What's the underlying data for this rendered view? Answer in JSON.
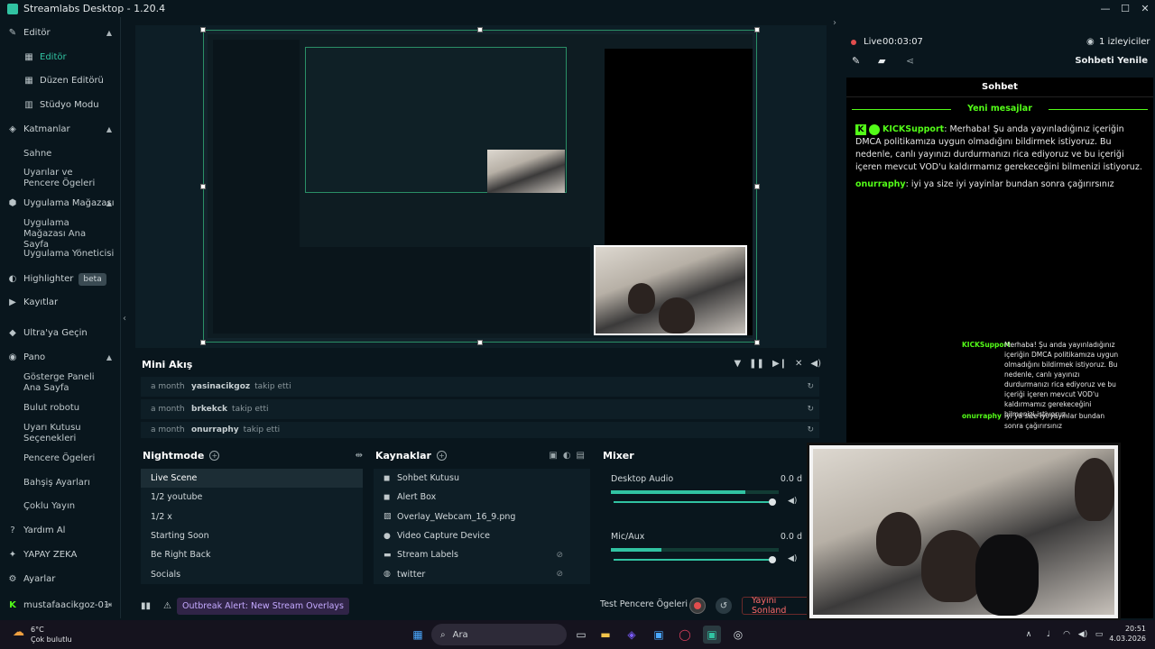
{
  "window": {
    "title": "Streamlabs Desktop - 1.20.4",
    "controls": [
      "—",
      "☐",
      "✕"
    ]
  },
  "sidebar": {
    "items": [
      {
        "label": "Editör",
        "icon": "editor-icon",
        "type": "section"
      },
      {
        "label": "Editör",
        "icon": "editor-grid-icon",
        "type": "sub-active"
      },
      {
        "label": "Düzen Editörü",
        "icon": "layout-icon",
        "type": "sub"
      },
      {
        "label": "Stüdyo Modu",
        "icon": "studio-icon",
        "type": "sub"
      },
      {
        "label": "Katmanlar",
        "icon": "layers-icon",
        "type": "section"
      },
      {
        "label": "Sahne",
        "type": "plain"
      },
      {
        "label": "Uyarılar ve Pencere Ögeleri",
        "type": "plain"
      },
      {
        "label": "Uygulama Mağazası",
        "icon": "store-icon",
        "type": "section"
      },
      {
        "label": "Uygulama Mağazası Ana Sayfa",
        "type": "plain"
      },
      {
        "label": "Uygulama Yöneticisi",
        "type": "plain"
      },
      {
        "label": "Highlighter",
        "icon": "highlighter-icon",
        "type": "section",
        "badge": "beta"
      },
      {
        "label": "Kayıtlar",
        "icon": "recordings-icon",
        "type": "section"
      },
      {
        "label": "Ultra'ya Geçin",
        "icon": "ultra-icon",
        "type": "section"
      },
      {
        "label": "Pano",
        "icon": "dashboard-icon",
        "type": "section"
      },
      {
        "label": "Gösterge Paneli Ana Sayfa",
        "type": "plain"
      },
      {
        "label": "Bulut robotu",
        "type": "plain"
      },
      {
        "label": "Uyarı Kutusu Seçenekleri",
        "type": "plain"
      },
      {
        "label": "Pencere Ögeleri",
        "type": "plain"
      },
      {
        "label": "Bahşiş Ayarları",
        "type": "plain"
      },
      {
        "label": "Çoklu Yayın",
        "type": "plain"
      },
      {
        "label": "Yardım Al",
        "icon": "help-icon",
        "type": "section"
      },
      {
        "label": "YAPAY ZEKA",
        "icon": "ai-icon",
        "type": "section"
      },
      {
        "label": "Ayarlar",
        "icon": "settings-icon",
        "type": "section"
      }
    ],
    "account": "mustafaacikgoz-01"
  },
  "mini_feed": {
    "title": "Mini Akış",
    "rows": [
      {
        "time": "a month",
        "user": "yasinacikgoz",
        "action": "takip etti"
      },
      {
        "time": "a month",
        "user": "brkekck",
        "action": "takip etti"
      },
      {
        "time": "a month",
        "user": "onurraphy",
        "action": "takip etti"
      }
    ]
  },
  "scenes": {
    "title": "Nightmode",
    "items": [
      "Live Scene",
      "1/2 youtube",
      "1/2 x",
      "Starting Soon",
      "Be Right Back",
      "Socials"
    ],
    "selected": 0
  },
  "sources": {
    "title": "Kaynaklar",
    "items": [
      {
        "label": "Sohbet Kutusu",
        "icon": "chat-box-icon",
        "hidden": false
      },
      {
        "label": "Alert Box",
        "icon": "alert-box-icon",
        "hidden": false
      },
      {
        "label": "Overlay_Webcam_16_9.png",
        "icon": "image-icon",
        "hidden": false
      },
      {
        "label": "Video Capture Device",
        "icon": "camera-icon",
        "hidden": false
      },
      {
        "label": "Stream Labels",
        "icon": "folder-icon",
        "hidden": true
      },
      {
        "label": "twitter",
        "icon": "globe-icon",
        "hidden": true
      }
    ]
  },
  "mixer": {
    "title": "Mixer",
    "channels": [
      {
        "name": "Desktop Audio",
        "db": "0.0 d",
        "level": 0.8,
        "volume": 1.0
      },
      {
        "name": "Mic/Aux",
        "db": "0.0 d",
        "level": 0.3,
        "volume": 1.0
      }
    ]
  },
  "bottom": {
    "alert": "Outbreak Alert: New Stream Overlays",
    "test_widgets": "Test Pencere Ögeleri",
    "go_live": "Yayını Sonland"
  },
  "live": {
    "status": "Live",
    "time": "00:03:07",
    "viewers": "1 izleyiciler",
    "refresh_chat": "Sohbeti Yenile"
  },
  "chat": {
    "title": "Sohbet",
    "new_messages": "Yeni mesajlar",
    "messages": [
      {
        "user": "KICKSupport",
        "text": "Merhaba! Şu anda yayınladığınız içeriğin DMCA politikamıza uygun olmadığını bildirmek istiyoruz. Bu nedenle, canlı yayınızı durdurmanızı rica ediyoruz ve bu içeriği içeren mevcut VOD'u kaldırmamız gerekeceğini bilmenizi istiyoruz."
      },
      {
        "user": "onurraphy",
        "text": "iyi ya size iyi yayinlar bundan sonra çağırırsınız"
      }
    ],
    "overlay_messages": [
      {
        "user": "KICKSupport",
        "text": "Merhaba! Şu anda yayınladığınız içeriğin DMCA politikamıza uygun olmadığını bildirmek istiyoruz. Bu nedenle, canlı yayınızı durdurmanızı rica ediyoruz ve bu içeriği içeren mevcut VOD'u kaldırmamız gerekeceğini bilmenizi istiyoruz."
      },
      {
        "user": "onurraphy",
        "text": "iyi ya size iyi yayinlar bundan sonra çağırırsınız"
      }
    ]
  },
  "taskbar": {
    "weather_temp": "6°C",
    "weather_desc": "Çok bulutlu",
    "search": "Ara",
    "time": "20:51",
    "date": "4.03.2026"
  }
}
